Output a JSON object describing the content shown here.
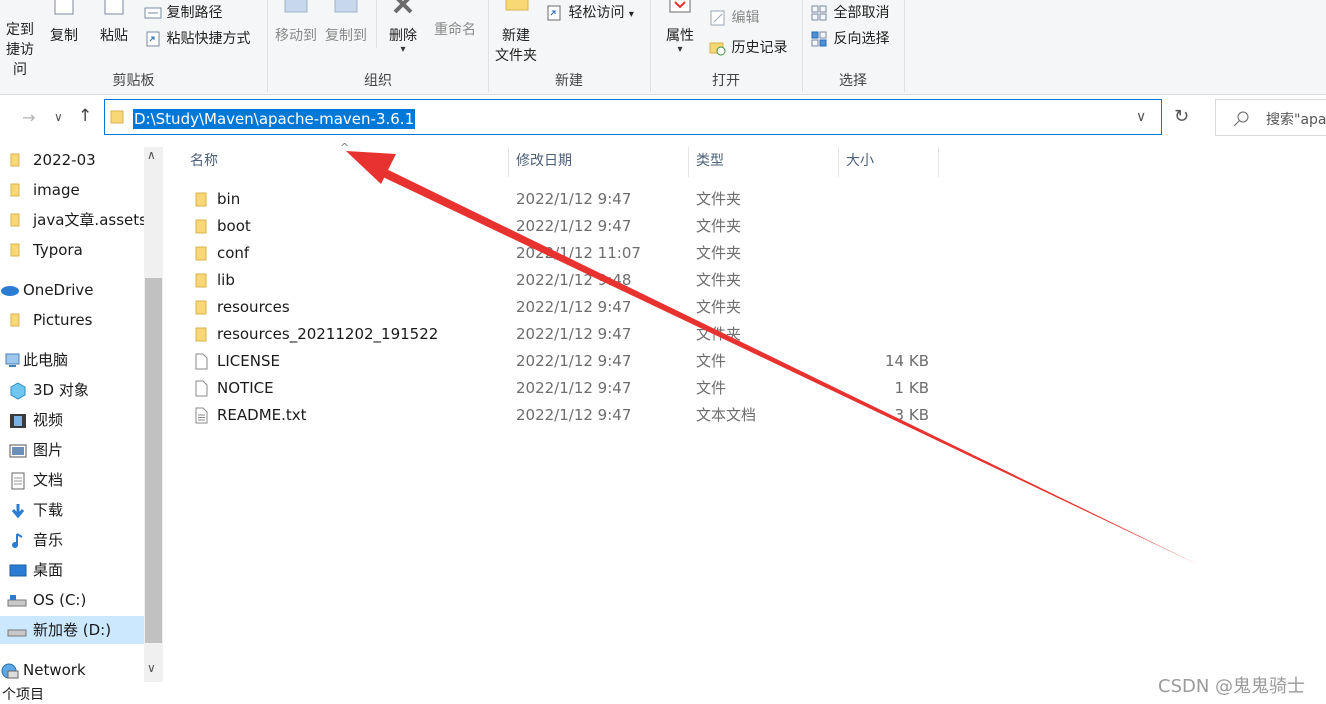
{
  "ribbon": {
    "clipboard": {
      "pin_label_1": "定到",
      "pin_label_2": "捷访问",
      "copy": "复制",
      "paste": "粘贴",
      "copy_path": "复制路径",
      "paste_shortcut": "粘贴快捷方式",
      "group": "剪贴板"
    },
    "organize": {
      "move_to": "移动到",
      "copy_to": "复制到",
      "delete": "删除",
      "rename": "重命名",
      "group": "组织"
    },
    "new": {
      "new_folder_1": "新建",
      "new_folder_2": "文件夹",
      "easy_access": "轻松访问",
      "group": "新建"
    },
    "open": {
      "properties": "属性",
      "edit": "编辑",
      "history": "历史记录",
      "group": "打开"
    },
    "select": {
      "select_none": "全部取消",
      "invert": "反向选择",
      "group": "选择"
    }
  },
  "address": {
    "path": "D:\\Study\\Maven\\apache-maven-3.6.1",
    "search_placeholder": "搜索\"apa"
  },
  "sidebar": {
    "items": [
      {
        "label": "2022-03",
        "icon": "folder-icon"
      },
      {
        "label": "image",
        "icon": "folder-icon"
      },
      {
        "label": "java文章.assets",
        "icon": "folder-icon"
      },
      {
        "label": "Typora",
        "icon": "folder-icon"
      },
      {
        "label": "OneDrive",
        "icon": "cloud-icon"
      },
      {
        "label": "Pictures",
        "icon": "folder-icon"
      },
      {
        "label": "此电脑",
        "icon": "computer-icon"
      },
      {
        "label": "3D 对象",
        "icon": "cube-icon"
      },
      {
        "label": "视频",
        "icon": "video-icon"
      },
      {
        "label": "图片",
        "icon": "picture-icon"
      },
      {
        "label": "文档",
        "icon": "document-icon"
      },
      {
        "label": "下载",
        "icon": "download-icon"
      },
      {
        "label": "音乐",
        "icon": "music-icon"
      },
      {
        "label": "桌面",
        "icon": "desktop-icon"
      },
      {
        "label": "OS (C:)",
        "icon": "drive-icon"
      },
      {
        "label": "新加卷 (D:)",
        "icon": "drive-icon"
      },
      {
        "label": "Network",
        "icon": "network-icon"
      }
    ]
  },
  "columns": {
    "name": "名称",
    "modified": "修改日期",
    "type": "类型",
    "size": "大小"
  },
  "files": [
    {
      "name": "bin",
      "date": "2022/1/12 9:47",
      "type": "文件夹",
      "size": "",
      "icon": "folder-icon"
    },
    {
      "name": "boot",
      "date": "2022/1/12 9:47",
      "type": "文件夹",
      "size": "",
      "icon": "folder-icon"
    },
    {
      "name": "conf",
      "date": "2022/1/12 11:07",
      "type": "文件夹",
      "size": "",
      "icon": "folder-icon"
    },
    {
      "name": "lib",
      "date": "2022/1/12 9:48",
      "type": "文件夹",
      "size": "",
      "icon": "folder-icon"
    },
    {
      "name": "resources",
      "date": "2022/1/12 9:47",
      "type": "文件夹",
      "size": "",
      "icon": "folder-icon"
    },
    {
      "name": "resources_20211202_191522",
      "date": "2022/1/12 9:47",
      "type": "文件夹",
      "size": "",
      "icon": "folder-icon"
    },
    {
      "name": "LICENSE",
      "date": "2022/1/12 9:47",
      "type": "文件",
      "size": "14 KB",
      "icon": "file-icon"
    },
    {
      "name": "NOTICE",
      "date": "2022/1/12 9:47",
      "type": "文件",
      "size": "1 KB",
      "icon": "file-icon"
    },
    {
      "name": "README.txt",
      "date": "2022/1/12 9:47",
      "type": "文本文档",
      "size": "3 KB",
      "icon": "text-file-icon"
    }
  ],
  "status": {
    "count": "个项目"
  },
  "watermark": "CSDN @鬼鬼骑士",
  "colors": {
    "accent": "#0078d7",
    "folder": "#f8d775",
    "arrow": "#e8322f",
    "selected_nav": "#cce8ff"
  }
}
